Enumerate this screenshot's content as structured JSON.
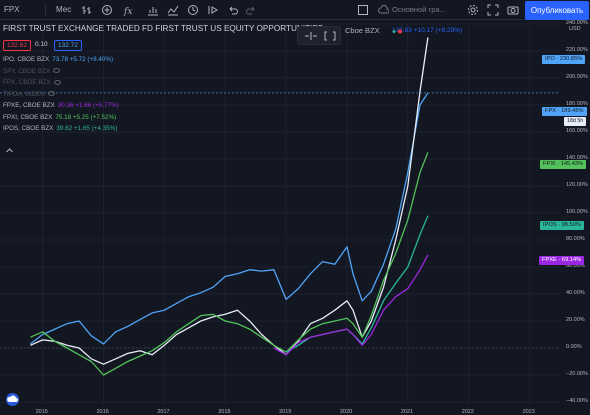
{
  "toolbar": {
    "symbol": "FPX",
    "interval": "Мес",
    "layout_name": "Основной гра...",
    "publish_label": "Опубликовать"
  },
  "legend": {
    "title": "FIRST TRUST EXCHANGE TRADED FD FIRST TRUST US EQUITY OPPORTUNITIES",
    "exchange": "Cboe BZX",
    "bid": "132.62",
    "spread": "0.10",
    "ask": "132.72",
    "main_quote": "132.83 +10.17 (+8.29%)",
    "rows": [
      {
        "name": "IPO, CBOE BZX",
        "values": "73.78 +5.72 (+8.40%)",
        "color": "#4fa4f7",
        "dim": false
      },
      {
        "name": "SPY, CBOE BZX",
        "values": "",
        "color": "#50535e",
        "dim": true
      },
      {
        "name": "FPX, CBOE BZX",
        "values": "",
        "color": "#50535e",
        "dim": true
      },
      {
        "name": "TIPOA, INDEX",
        "values": "",
        "color": "#50535e",
        "dim": true
      },
      {
        "name": "FPXE, CBOE BZX",
        "values": "30.36 +1.66 (+5.77%)",
        "color": "#9c27e0",
        "dim": false
      },
      {
        "name": "FPXI, CBOE BZX",
        "values": "75.18 +5.25 (+7.52%)",
        "color": "#53c25a",
        "dim": false
      },
      {
        "name": "IPOS, CBOE BZX",
        "values": "39.62 +1.65 (+4.35%)",
        "color": "#2ab59b",
        "dim": false
      }
    ]
  },
  "axis": {
    "currency": "USD",
    "badges": {
      "ipo": "IPO · 230.85%",
      "fpx": "FPX · 189.45%",
      "fpx_countdown": "18d 5h",
      "fpxi": "FPXI · 145.43%",
      "ipos": "IPOS · 98.50%",
      "fpxe": "FPXE · 69.14%"
    }
  },
  "chart_data": {
    "type": "line",
    "y_unit": "%",
    "ylim": [
      -40,
      240
    ],
    "y_ticks": [
      240,
      220,
      200,
      180,
      160,
      140,
      120,
      100,
      80,
      60,
      40,
      20,
      0,
      -20,
      -40
    ],
    "x_ticks": [
      "2015",
      "2016",
      "2017",
      "2018",
      "2019",
      "2020",
      "2021",
      "2022",
      "2023"
    ],
    "series": [
      {
        "name": "IPO",
        "color": "#4fa4f7",
        "x": [
          2014.8,
          2015.0,
          2015.2,
          2015.4,
          2015.6,
          2015.8,
          2016.0,
          2016.2,
          2016.4,
          2016.6,
          2016.8,
          2017.0,
          2017.2,
          2017.4,
          2017.6,
          2017.8,
          2018.0,
          2018.2,
          2018.4,
          2018.6,
          2018.8,
          2019.0,
          2019.2,
          2019.4,
          2019.6,
          2019.8,
          2020.0,
          2020.1,
          2020.25,
          2020.4,
          2020.6,
          2020.8,
          2021.0,
          2021.2,
          2021.33
        ],
        "y": [
          3,
          10,
          14,
          18,
          20,
          9,
          3,
          12,
          16,
          21,
          26,
          28,
          33,
          38,
          41,
          45,
          53,
          55,
          58,
          57,
          58,
          36,
          44,
          55,
          64,
          62,
          75,
          55,
          35,
          42,
          62,
          88,
          130,
          180,
          189
        ]
      },
      {
        "name": "FPX",
        "color": "#e8eef7",
        "x": [
          2014.8,
          2015.0,
          2015.2,
          2015.4,
          2015.6,
          2015.8,
          2016.0,
          2016.2,
          2016.4,
          2016.6,
          2016.8,
          2017.0,
          2017.2,
          2017.4,
          2017.6,
          2017.8,
          2018.0,
          2018.2,
          2018.4,
          2018.6,
          2018.8,
          2019.0,
          2019.2,
          2019.4,
          2019.6,
          2019.8,
          2020.0,
          2020.1,
          2020.25,
          2020.4,
          2020.6,
          2020.8,
          2021.0,
          2021.2,
          2021.33
        ],
        "y": [
          2,
          6,
          5,
          2,
          0,
          -8,
          -12,
          -8,
          -4,
          -2,
          -5,
          2,
          10,
          15,
          20,
          23,
          25,
          28,
          20,
          10,
          2,
          -5,
          5,
          18,
          22,
          28,
          35,
          28,
          8,
          20,
          45,
          80,
          120,
          190,
          230
        ]
      },
      {
        "name": "FPXI",
        "color": "#53c25a",
        "x": [
          2014.8,
          2015.0,
          2015.2,
          2015.4,
          2015.6,
          2015.8,
          2016.0,
          2016.2,
          2016.4,
          2016.6,
          2016.8,
          2017.0,
          2017.2,
          2017.4,
          2017.6,
          2017.8,
          2018.0,
          2018.2,
          2018.4,
          2018.6,
          2018.8,
          2019.0,
          2019.2,
          2019.4,
          2019.6,
          2019.8,
          2020.0,
          2020.1,
          2020.25,
          2020.4,
          2020.6,
          2020.8,
          2021.0,
          2021.2,
          2021.33
        ],
        "y": [
          8,
          12,
          5,
          0,
          -5,
          -10,
          -20,
          -15,
          -10,
          -6,
          -2,
          4,
          12,
          18,
          24,
          25,
          20,
          18,
          14,
          8,
          2,
          -3,
          6,
          14,
          18,
          20,
          22,
          18,
          8,
          24,
          50,
          70,
          95,
          130,
          145
        ]
      },
      {
        "name": "IPOS",
        "color": "#2ab59b",
        "x": [
          2019.0,
          2019.2,
          2019.4,
          2019.6,
          2019.8,
          2020.0,
          2020.1,
          2020.25,
          2020.4,
          2020.6,
          2020.8,
          2021.0,
          2021.2,
          2021.33
        ],
        "y": [
          -3,
          2,
          8,
          10,
          12,
          14,
          10,
          3,
          15,
          35,
          48,
          60,
          84,
          98
        ]
      },
      {
        "name": "FPXE",
        "color": "#9c27e0",
        "x": [
          2018.8,
          2019.0,
          2019.2,
          2019.4,
          2019.6,
          2019.8,
          2020.0,
          2020.1,
          2020.25,
          2020.4,
          2020.6,
          2020.8,
          2021.0,
          2021.2,
          2021.33
        ],
        "y": [
          0,
          -5,
          4,
          8,
          10,
          12,
          14,
          10,
          2,
          10,
          28,
          38,
          44,
          58,
          69
        ]
      }
    ]
  }
}
